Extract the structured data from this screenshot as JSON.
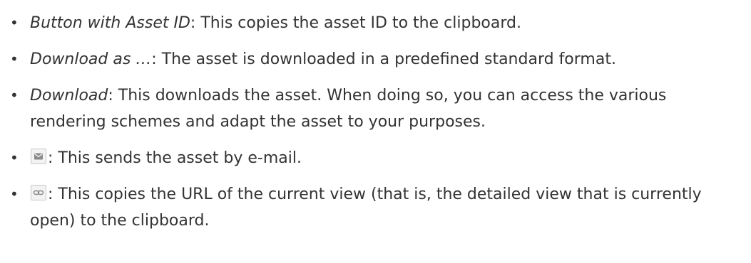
{
  "bullet_symbol": "•",
  "items": [
    {
      "term": "Button with Asset ID",
      "text": ": This copies the asset ID to the clipboard."
    },
    {
      "term": "Download as …",
      "text": ": The asset is downloaded in a predefined standard format."
    },
    {
      "term": "Download",
      "text": ": This downloads the asset. When doing so, you can access the various rendering schemes and adapt the asset to your purposes."
    },
    {
      "icon": "email-icon",
      "text": ": This sends the asset by e-mail."
    },
    {
      "icon": "link-icon",
      "text": ": This copies the URL of the current view (that is, the detailed view that is currently open) to the clipboard."
    }
  ],
  "colors": {
    "text": "#333333",
    "icon_border": "#c8c8c8",
    "icon_bg": "#f3f3f3",
    "icon_glyph": "#8a8a8a"
  }
}
